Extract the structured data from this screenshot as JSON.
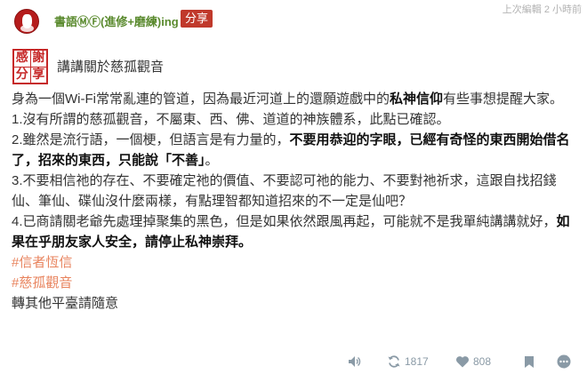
{
  "header": {
    "user_name": "書語ⓂⒻ(進修+磨練)ing",
    "share_label": "分享",
    "timestamp": "上次編輯 2 小時前"
  },
  "post": {
    "stamp_chars": [
      "感",
      "謝",
      "分",
      "享"
    ],
    "title": "講講關於慈孤觀音",
    "p1a": "身為一個Wi-Fi常常亂連的管道，因為最近河道上的還願遊戲中的",
    "p1b": "私神信仰",
    "p1c": "有些事想提醒大家。",
    "p2": "1.沒有所謂的慈孤觀音，不屬東、西、佛、道道的神族體系，此點已確認。",
    "p3a": "2.雖然是流行語，一個梗，但語言是有力量的，",
    "p3b": "不要用恭迎的字眼，已經有奇怪的東西開始借名了，招來的東西，只能說「不善」",
    "p3c": "。",
    "p4": "3.不要相信祂的存在、不要確定祂的價值、不要認可祂的能力、不要對祂祈求，這跟自找招錢仙、筆仙、碟仙沒什麼兩樣，有點理智都知道招來的不一定是仙吧？",
    "p5a": "4.已商請關老爺先處理掉聚集的黑色，但是如果依然跟風再起，可能就不是我單純講講就好，",
    "p5b": "如果在乎朋友家人安全，請停止私神崇拜。",
    "tag1": "#信者恆信",
    "tag2": "#慈孤觀音",
    "closing": "轉其他平臺請隨意"
  },
  "actions": {
    "mute_icon": "speaker-icon",
    "reshare_icon": "refresh-icon",
    "reshare_count": "1817",
    "like_icon": "heart-icon",
    "like_count": "808",
    "bookmark_icon": "bookmark-icon",
    "more_icon": "more-dots-icon"
  },
  "colors": {
    "username": "#5a8a2e",
    "share_badge": "#c0392b",
    "hashtag": "#e8835d",
    "action_gray": "#8a9aa6",
    "stamp_red": "#c62828"
  }
}
